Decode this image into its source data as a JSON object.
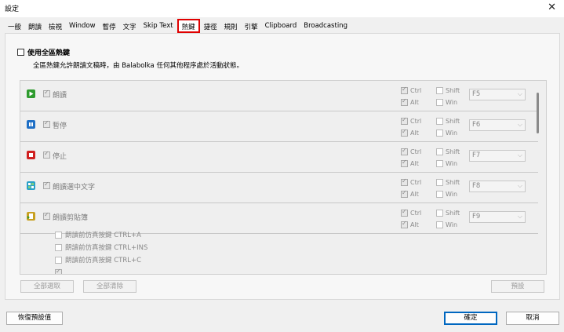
{
  "window": {
    "title": "設定",
    "close_glyph": "✕"
  },
  "tabs": [
    "一般",
    "朗讀",
    "檢視",
    "Window",
    "暫停",
    "文字",
    "Skip Text",
    "熱鍵",
    "捷徑",
    "規則",
    "引擎",
    "Clipboard",
    "Broadcasting"
  ],
  "active_tab": "熱鍵",
  "global": {
    "label": "使用全區熱鍵",
    "checked": false
  },
  "description": "全區熱鍵允許朗讀文稿時，由 Balabolka 任何其他程序處於活動狀態。",
  "hotkeys": [
    {
      "label": "朗讀",
      "icon": "play-icon",
      "icon_color": "#2e9b2e",
      "ctrl": true,
      "shift": false,
      "alt": true,
      "win": false,
      "key": "F5"
    },
    {
      "label": "暫停",
      "icon": "pause-icon",
      "icon_color": "#1f6fc5",
      "ctrl": true,
      "shift": false,
      "alt": true,
      "win": false,
      "key": "F6"
    },
    {
      "label": "停止",
      "icon": "stop-icon",
      "icon_color": "#d02020",
      "ctrl": true,
      "shift": false,
      "alt": true,
      "win": false,
      "key": "F7"
    },
    {
      "label": "朗讀選中文字",
      "icon": "read-selection-icon",
      "icon_color": "#2aa0c8",
      "ctrl": true,
      "shift": false,
      "alt": true,
      "win": false,
      "key": "F8"
    },
    {
      "label": "朗讀剪貼簿",
      "icon": "read-clipboard-icon",
      "icon_color": "#c8a020",
      "ctrl": true,
      "shift": false,
      "alt": true,
      "win": false,
      "key": "F9"
    }
  ],
  "mod_labels": {
    "ctrl": "Ctrl",
    "shift": "Shift",
    "alt": "Alt",
    "win": "Win"
  },
  "clipboard_options": [
    "朗讀前仿真按鍵 CTRL+A",
    "朗讀前仿真按鍵 CTRL+INS",
    "朗讀前仿真按鍵 CTRL+C"
  ],
  "buttons": {
    "select_all": "全部選取",
    "clear_all": "全部清除",
    "default_key": "預設",
    "reset": "恢復預設值",
    "ok": "確定",
    "cancel": "取消"
  }
}
